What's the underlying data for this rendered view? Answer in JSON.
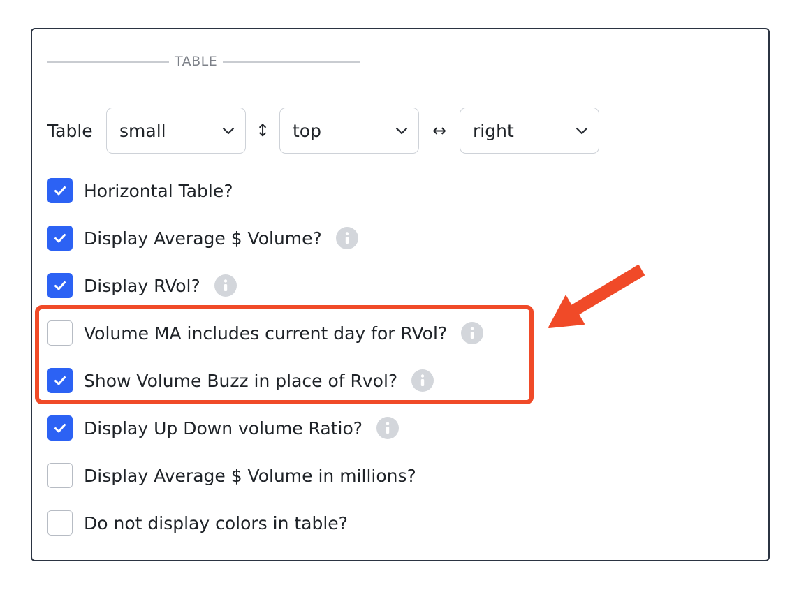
{
  "section": {
    "title": "TABLE"
  },
  "table_row": {
    "label": "Table",
    "size_select": "small",
    "vertical_icon": "↕",
    "vertical_select": "top",
    "horizontal_icon": "↔",
    "horizontal_select": "right"
  },
  "options": [
    {
      "label": "Horizontal Table?",
      "checked": true,
      "info": false
    },
    {
      "label": "Display Average $ Volume?",
      "checked": true,
      "info": true
    },
    {
      "label": "Display RVol?",
      "checked": true,
      "info": true
    },
    {
      "label": "Volume MA includes current day for RVol?",
      "checked": false,
      "info": true
    },
    {
      "label": "Show Volume Buzz in place of Rvol?",
      "checked": true,
      "info": true
    },
    {
      "label": "Display Up Down volume Ratio?",
      "checked": true,
      "info": true
    },
    {
      "label": "Display Average $ Volume in millions?",
      "checked": false,
      "info": false
    },
    {
      "label": "Do not display colors in table?",
      "checked": false,
      "info": false
    }
  ],
  "colors": {
    "accent": "#2c62f4",
    "highlight": "#f04a28",
    "info_bg": "#d3d6db"
  },
  "icons": {
    "check": "check-icon",
    "info": "info-icon",
    "chevron": "chevron-down-icon",
    "annotation": "arrow-annotation-icon"
  }
}
